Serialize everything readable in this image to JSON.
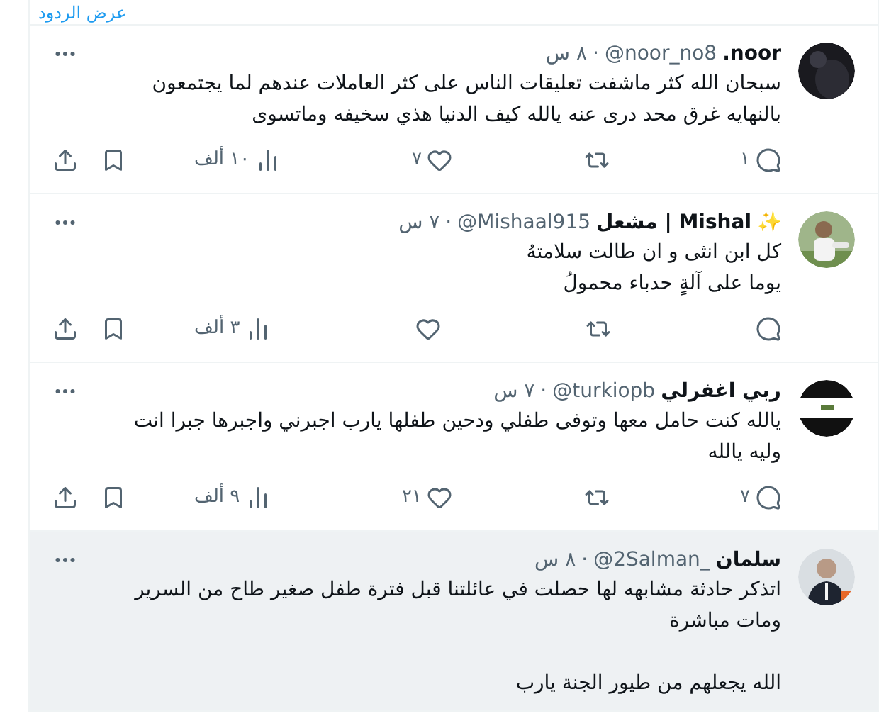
{
  "show_replies_link": "عرض الردود",
  "separator": "·",
  "tweets": [
    {
      "name": "noor.",
      "handle": "@noor_no8",
      "time": "٨ س",
      "text": "سبحان الله كثر ماشفت تعليقات الناس على كثر العاملات عندهم لما يجتمعون بالنهايه غرق محد درى عنه يالله كيف الدنيا هذي سخيفه وماتسوى",
      "replies": "١",
      "likes": "٧",
      "views": "١٠ ألف",
      "hovered": false,
      "show_actions": true
    },
    {
      "name": "Mishal | مشعل",
      "emoji": "✨",
      "handle": "@Mishaal915",
      "time": "٧ س",
      "text": "كل ابن انثى و ان طالت سلامتهُ\nيوما على آلةٍ حدباء محمولُ",
      "views": "٣ ألف",
      "hovered": false,
      "show_actions": true
    },
    {
      "name": "ربي اغفرلي",
      "handle": "@turkiopb",
      "time": "٧ س",
      "text": "يالله كنت حامل معها وتوفى طفلي ودحين طفلها يارب اجبرني واجبرها جبرا انت وليه يالله",
      "replies": "٧",
      "likes": "٢١",
      "views": "٩ ألف",
      "hovered": false,
      "show_actions": true
    },
    {
      "name": "سلمان",
      "handle": "@2Salman_",
      "time": "٨ س",
      "text": "اتذكر حادثة مشابهه لها حصلت في عائلتنا قبل فترة طفل صغير طاح من السرير ومات مباشرة\n\nالله يجعلهم من طيور الجنة يارب",
      "hovered": true,
      "show_actions": false
    }
  ]
}
